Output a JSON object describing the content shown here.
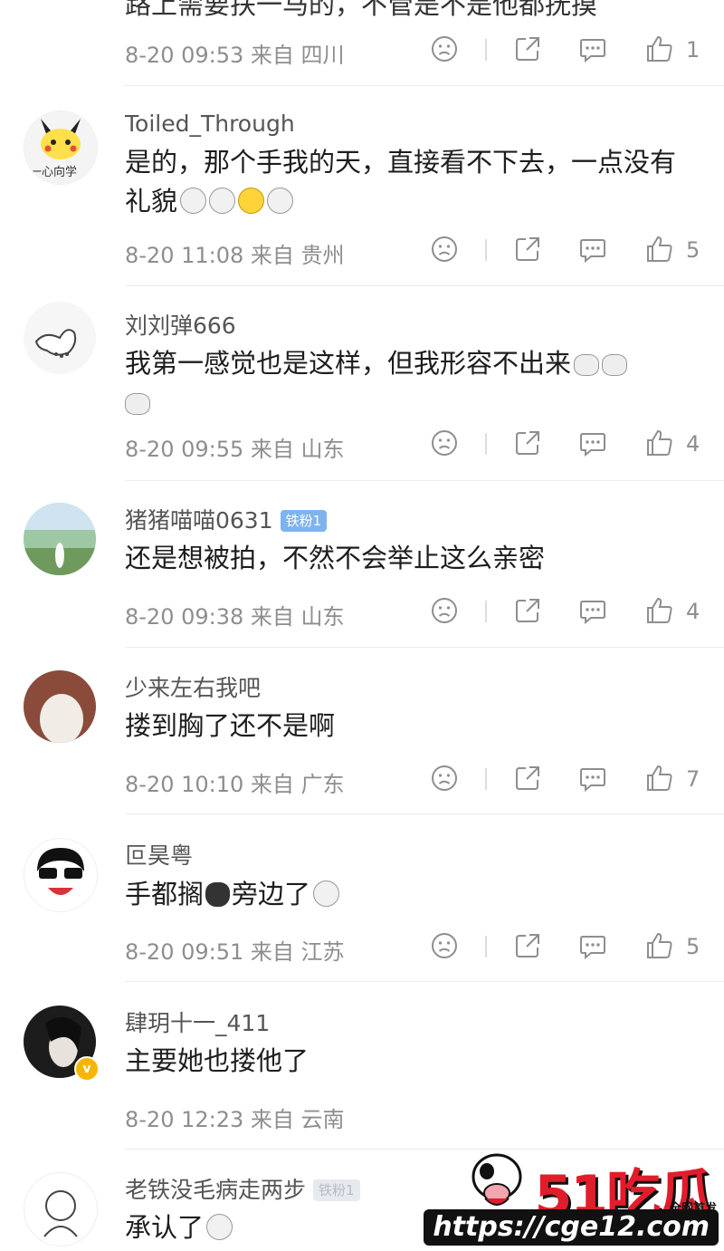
{
  "partial_top": {
    "text": "路上需要扶一马的，不管是不是他都抚摸",
    "time": "8-20 09:53 来自 四川",
    "likes": "1"
  },
  "comments": [
    {
      "username": "Toiled_Through",
      "text": "是的，那个手我的天，直接看不下去，一点没有礼貌",
      "time": "8-20 11:08 来自 贵州",
      "likes": "5",
      "avatar_caption": "一心向学"
    },
    {
      "username": "刘刘弹666",
      "text": "我第一感觉也是这样，但我形容不出来",
      "time": "8-20 09:55 来自 山东",
      "likes": "4"
    },
    {
      "username": "猪猪喵喵0631",
      "badge": "铁粉1",
      "text": "还是想被拍，不然不会举止这么亲密",
      "time": "8-20 09:38 来自 山东",
      "likes": "4"
    },
    {
      "username": "少来左右我吧",
      "text": "搂到胸了还不是啊",
      "time": "8-20 10:10 来自 广东",
      "likes": "7"
    },
    {
      "username": "叵昊粤",
      "text_a": "手都搁",
      "text_b": "旁边了",
      "time": "8-20 09:51 来自 江苏",
      "likes": "5"
    },
    {
      "username": "肆玥十一_411",
      "text": "主要她也搂他了",
      "time": "8-20 12:23 来自 云南",
      "likes": ""
    },
    {
      "username": "老铁没毛病走两步",
      "badge": "铁粉1",
      "text": "承认了"
    }
  ],
  "watermark": {
    "logo": "51吃瓜",
    "url": "https://cge12.com",
    "mark": "全网首发"
  },
  "icons": {
    "dislike": "frown-face-icon",
    "share": "share-icon",
    "comment": "comment-icon",
    "like": "thumbs-up-icon"
  },
  "colors": {
    "meta": "#8e8e8e",
    "badge": "#7fb3ef",
    "brand_red": "#e21d2b"
  }
}
